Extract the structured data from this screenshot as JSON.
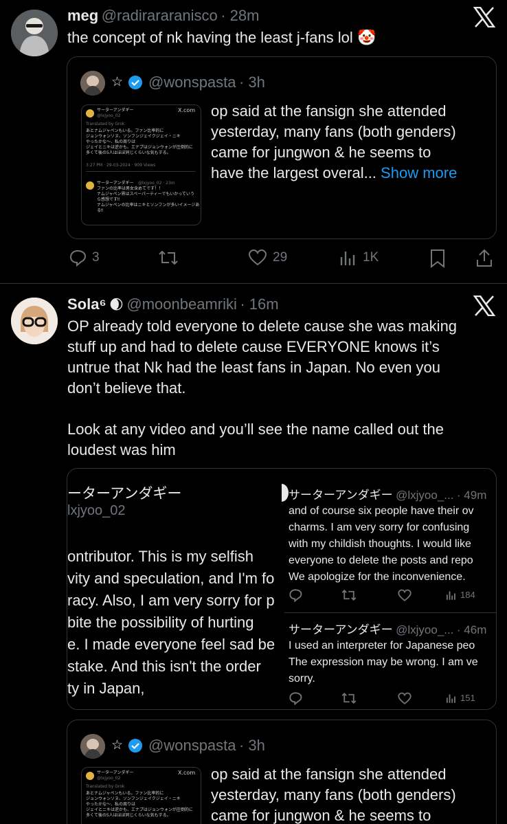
{
  "tweet1": {
    "name": "meg",
    "handle": "@radirararanisco",
    "time": "· 28m",
    "text": "the concept of nk having the least j-fans lol",
    "emoji": "🤡",
    "quote": {
      "handle": "@wonspasta",
      "time": "· 3h",
      "lines": [
        "op said at the fansign she attended",
        "yesterday, many fans (both genders)",
        "came for jungwon & he seems to",
        "have the largest overal..."
      ],
      "show_more": "Show more",
      "mini": {
        "name": "サーターアンダギー",
        "handle": "@lxjyoo_02",
        "xcom": "X.com",
        "translated": "Translated by Grok",
        "lines": [
          "あとナムジャペンもいる。ファン比率的に",
          "ジョンウォンソヌ、ソンフンジェイクジェイ・ニキ",
          "やったかな〜、私の周りは",
          "ジェイとニキは逆かも、エナプはジョンウォンが圧倒的に",
          "多くて後の5人はほぼ同じくらいな気もする。"
        ],
        "meta": "3:27 PM · 29-03-2024 · 909 Views",
        "reply_name": "サーターアンダギー",
        "reply_handle": "@lxjyoo_02 · 23m",
        "reply_lines": [
          "ファンの比率は男女含めてです！！",
          "ナムジャペン界はスペーパーティーでもいかっていう",
          "ら感想です‼",
          "ナムジャペンの比率はニキとソンフンが多いイメージあ",
          "る‼"
        ]
      }
    },
    "actions": {
      "replies": "3",
      "likes": "29",
      "views": "1K"
    }
  },
  "tweet2": {
    "name": "Sola⁶",
    "moon": "🌒",
    "handle": "@moonbeamriki",
    "time": "· 16m",
    "lines": [
      "OP already told everyone to delete cause she was making",
      "stuff up and had to delete cause EVERYONE knows it’s",
      "untrue that Nk had the least fans in Japan. No even you",
      "don’t believe that.",
      "",
      "Look at any video and you’ll see the name called out the",
      "loudest was him"
    ],
    "image": {
      "left_name": "ーターアンダギー",
      "left_handle": "lxjyoo_02",
      "left_lines": [
        "ontributor. This is my selfish",
        "vity and speculation, and I'm fo",
        "racy. Also, I am very sorry for p",
        "bite the possibility of hurting",
        "e. I made everyone feel sad be",
        "stake. And this isn't the order",
        "ty in Japan,"
      ],
      "reply1": {
        "name": "サーターアンダギー",
        "handle": "@lxjyoo_...",
        "time": "· 49m",
        "lines": [
          "and of course six people have their ov",
          "charms. I am very sorry for confusing",
          "with my childish thoughts. I would like",
          "everyone to delete the posts and repo",
          "We apologize for the inconvenience."
        ],
        "views": "184"
      },
      "reply2": {
        "name": "サーターアンダギー",
        "handle": "@lxjyoo_...",
        "time": "· 46m",
        "lines": [
          "I used an interpreter for Japanese peo",
          "The expression may be wrong. I am ve",
          "sorry."
        ],
        "views": "151"
      }
    },
    "quote": {
      "handle": "@wonspasta",
      "time": "· 3h",
      "lines": [
        "op said at the fansign she attended",
        "yesterday, many fans (both genders)",
        "came for jungwon & he seems to"
      ]
    }
  },
  "colors": {
    "background": "#000000",
    "text": "#e7e9ea",
    "muted": "#71767b",
    "accent": "#1d9bf0",
    "border": "#2f3336"
  }
}
